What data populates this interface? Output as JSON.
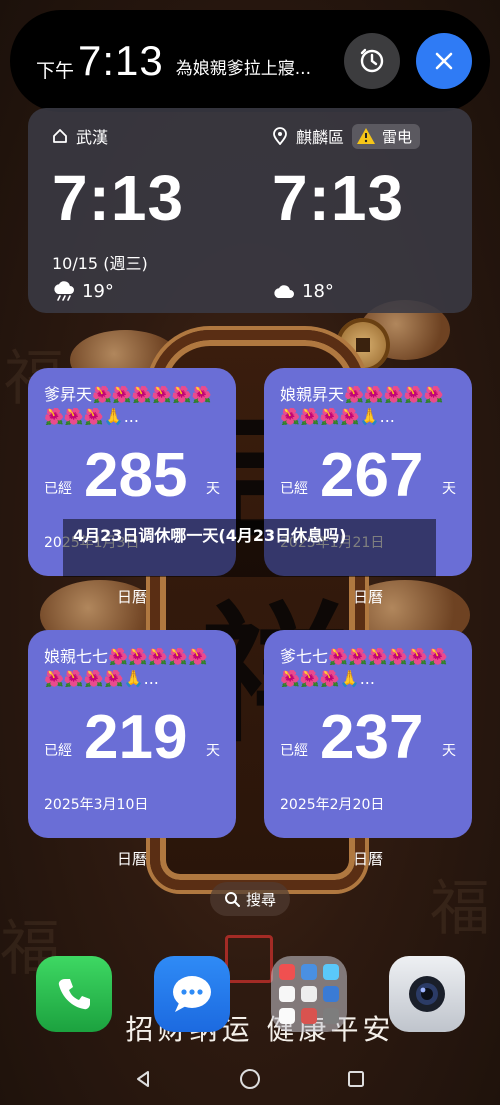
{
  "notification": {
    "ampm": "下午",
    "time": "7:13",
    "message": "為娘親爹拉上寢...",
    "clock_icon": "alarm-clock-icon",
    "close_icon": "close-icon",
    "accent": "#2f7bf5"
  },
  "weather": {
    "left": {
      "location": "武漢",
      "location_icon": "home-icon",
      "time": "7:13",
      "date": "10/15 (週三)",
      "temp": "19°",
      "condition_icon": "rain-cloud-icon"
    },
    "right": {
      "location": "麒麟區",
      "location_icon": "location-pin-icon",
      "alert": "雷电",
      "alert_icon": "warning-icon",
      "time": "7:13",
      "temp": "18°",
      "condition_icon": "cloudy-icon"
    }
  },
  "cards": [
    {
      "title": "爹昇天🌺🌺🌺🌺🌺🌺🌺🌺🌺🙏...",
      "prefix": "已經",
      "number": "285",
      "suffix": "天",
      "date": "2025年1月3日",
      "label": "日曆"
    },
    {
      "title": "娘親昇天🌺🌺🌺🌺🌺🌺🌺🌺🌺🙏...",
      "prefix": "已經",
      "number": "267",
      "suffix": "天",
      "date": "2025年1月21日",
      "label": "日曆"
    },
    {
      "title": "娘親七七🌺🌺🌺🌺🌺🌺🌺🌺🌺🙏...",
      "prefix": "已經",
      "number": "219",
      "suffix": "天",
      "date": "2025年3月10日",
      "label": "日曆"
    },
    {
      "title": "爹七七🌺🌺🌺🌺🌺🌺🌺🌺🌺🙏...",
      "prefix": "已經",
      "number": "237",
      "suffix": "天",
      "date": "2025年2月20日",
      "label": "日曆"
    }
  ],
  "banner": "4月23日调休哪一天(4月23日休息吗)",
  "search": {
    "label": "搜尋",
    "icon": "search-icon"
  },
  "wallpaper": {
    "calligraphy": "招财纳运 健康平安"
  },
  "dock": [
    "phone-icon",
    "message-icon",
    "app-folder-icon",
    "camera-icon"
  ],
  "nav": [
    "back-icon",
    "home-circle-icon",
    "recents-icon"
  ],
  "card_color": "#6a6ed6"
}
